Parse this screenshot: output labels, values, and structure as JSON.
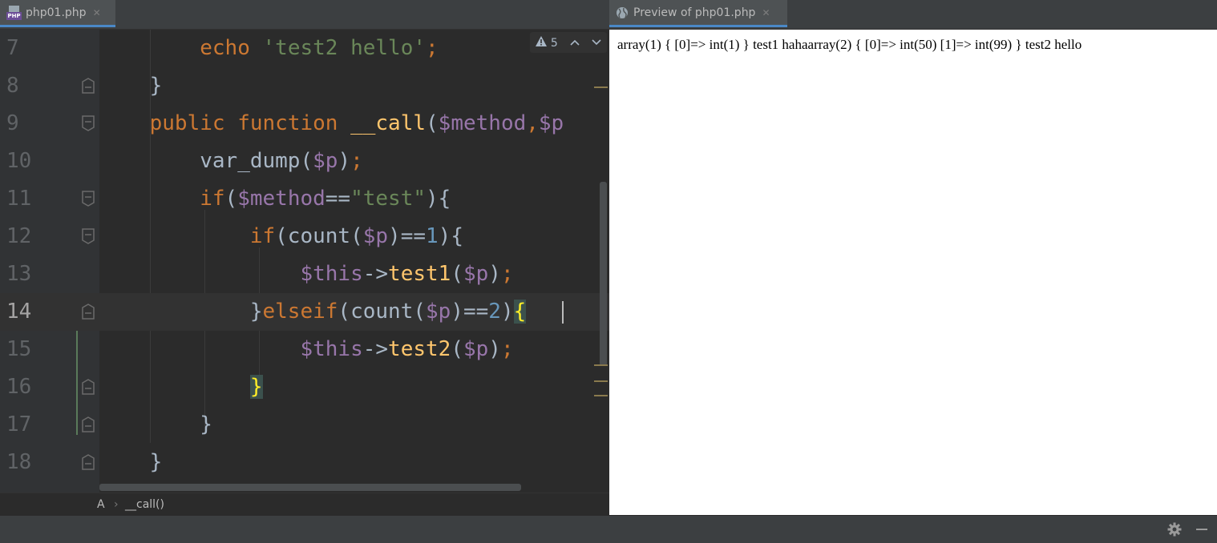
{
  "editor": {
    "tab_label": "php01.php",
    "tab_close": "✕",
    "inspection_count": "5",
    "lines": [
      {
        "number": "7"
      },
      {
        "number": "8"
      },
      {
        "number": "9"
      },
      {
        "number": "10"
      },
      {
        "number": "11"
      },
      {
        "number": "12"
      },
      {
        "number": "13"
      },
      {
        "number": "14"
      },
      {
        "number": "15"
      },
      {
        "number": "16"
      },
      {
        "number": "17"
      },
      {
        "number": "18"
      }
    ],
    "code": {
      "l7_kw": "echo",
      "l7_str": "'test2 hello'",
      "l7_semi": ";",
      "l8_brace": "}",
      "l9_kw1": "public",
      "l9_kw2": "function",
      "l9_fn": "__call",
      "l9_p1": "(",
      "l9_v1": "$method",
      "l9_comma": ",",
      "l9_v2": "$p",
      "l10_fn": "var_dump",
      "l10_p1": "(",
      "l10_v": "$p",
      "l10_p2": ")",
      "l10_semi": ";",
      "l11_kw": "if",
      "l11_p1": "(",
      "l11_v": "$method",
      "l11_op": "==",
      "l11_str": "\"test\"",
      "l11_p2": "){",
      "l12_kw": "if",
      "l12_t1": "(count(",
      "l12_v": "$p",
      "l12_t2": ")==",
      "l12_num": "1",
      "l12_t3": "){",
      "l13_v": "$this",
      "l13_arrow": "->",
      "l13_fn": "test1",
      "l13_p1": "(",
      "l13_v2": "$p",
      "l13_p2": ")",
      "l13_semi": ";",
      "l14_b": "}",
      "l14_kw": "elseif",
      "l14_t1": "(count(",
      "l14_v": "$p",
      "l14_t2": ")==",
      "l14_num": "2",
      "l14_t3": ")",
      "l14_brace": "{",
      "l15_v": "$this",
      "l15_arrow": "->",
      "l15_fn": "test2",
      "l15_p1": "(",
      "l15_v2": "$p",
      "l15_p2": ")",
      "l15_semi": ";",
      "l16_brace": "}",
      "l17_brace": "}",
      "l18_brace": "}"
    },
    "breadcrumb": {
      "class_name": "A",
      "separator": "›",
      "method_name": "__call()"
    }
  },
  "preview": {
    "tab_label": "Preview of php01.php",
    "tab_close": "✕",
    "output_text": "array(1) { [0]=> int(1) } test1 hahaarray(2) { [0]=> int(50) [1]=> int(99) } test2 hello"
  },
  "colors": {
    "editor_bg": "#2b2b2b",
    "gutter_bg": "#313335",
    "keyword": "#cc7832",
    "function": "#ffc66d",
    "variable": "#9876aa",
    "string": "#6a8759",
    "number": "#6897bb",
    "tab_accent": "#4a88c7"
  },
  "icons": {
    "file_icon": "php-file-icon",
    "preview_icon": "globe-icon",
    "warning_icon": "warning-icon",
    "settings_icon": "gear-icon",
    "minimize_icon": "minimize-icon"
  }
}
